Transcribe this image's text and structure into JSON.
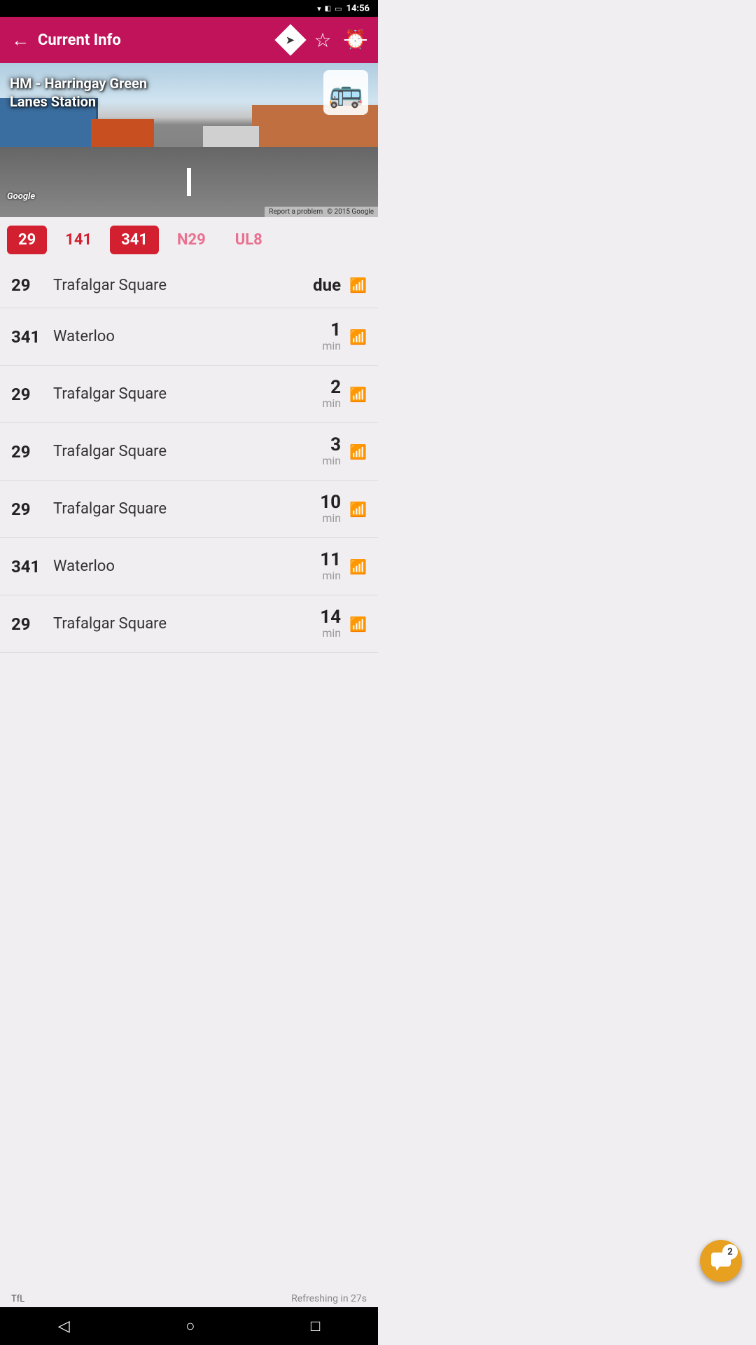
{
  "statusBar": {
    "time": "14:56",
    "icons": [
      "wifi",
      "sim",
      "battery"
    ]
  },
  "appBar": {
    "backLabel": "←",
    "title": "Current Info",
    "icons": [
      "directions",
      "star",
      "alarm-off"
    ]
  },
  "streetView": {
    "stationName": "HM - Harringay Green\nLanes Station",
    "googleWatermark": "Google",
    "reportProblem": "Report a problem",
    "copyright": "© 2015 Google"
  },
  "busTabs": [
    {
      "number": "29",
      "style": "active-red"
    },
    {
      "number": "141",
      "style": "inactive-red"
    },
    {
      "number": "341",
      "style": "active-red"
    },
    {
      "number": "N29",
      "style": "inactive-pink"
    },
    {
      "number": "UL8",
      "style": "inactive-pink"
    }
  ],
  "arrivals": [
    {
      "number": "29",
      "destination": "Trafalgar Square",
      "time": "due",
      "timeUnit": ""
    },
    {
      "number": "341",
      "destination": "Waterloo",
      "time": "1",
      "timeUnit": "min"
    },
    {
      "number": "29",
      "destination": "Trafalgar Square",
      "time": "2",
      "timeUnit": "min"
    },
    {
      "number": "29",
      "destination": "Trafalgar Square",
      "time": "3",
      "timeUnit": "min"
    },
    {
      "number": "29",
      "destination": "Trafalgar Square",
      "time": "10",
      "timeUnit": "min"
    },
    {
      "number": "341",
      "destination": "Waterloo",
      "time": "11",
      "timeUnit": "min"
    },
    {
      "number": "29",
      "destination": "Trafalgar Square",
      "time": "14",
      "timeUnit": "min"
    }
  ],
  "footer": {
    "tfl": "TfL",
    "refreshLabel": "Refreshing in 27s"
  },
  "fab": {
    "count": "2"
  },
  "nav": {
    "back": "◁",
    "home": "○",
    "recents": "□"
  }
}
